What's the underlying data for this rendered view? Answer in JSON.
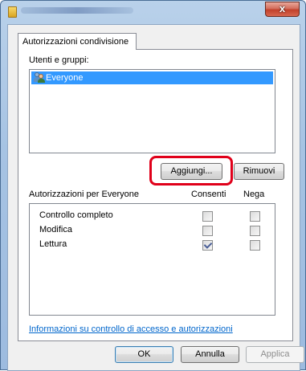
{
  "titlebar": {
    "close_glyph": "x"
  },
  "tab": {
    "label": "Autorizzazioni condivisione"
  },
  "users": {
    "label": "Utenti e gruppi:",
    "items": [
      {
        "label": "Everyone",
        "icon": "users-icon",
        "selected": true
      }
    ]
  },
  "buttons": {
    "add": "Aggiungi...",
    "remove": "Rimuovi"
  },
  "permissions": {
    "header": "Autorizzazioni per Everyone",
    "col_allow": "Consenti",
    "col_deny": "Nega",
    "rows": [
      {
        "name": "Controllo completo",
        "allow": false,
        "deny": false
      },
      {
        "name": "Modifica",
        "allow": false,
        "deny": false
      },
      {
        "name": "Lettura",
        "allow": true,
        "deny": false
      }
    ]
  },
  "link": {
    "text": "Informazioni su controllo di accesso e autorizzazioni"
  },
  "footer": {
    "ok": "OK",
    "cancel": "Annulla",
    "apply": "Applica"
  },
  "colors": {
    "highlight": "#e0001a",
    "selection": "#3399ff",
    "link": "#0066cc"
  }
}
